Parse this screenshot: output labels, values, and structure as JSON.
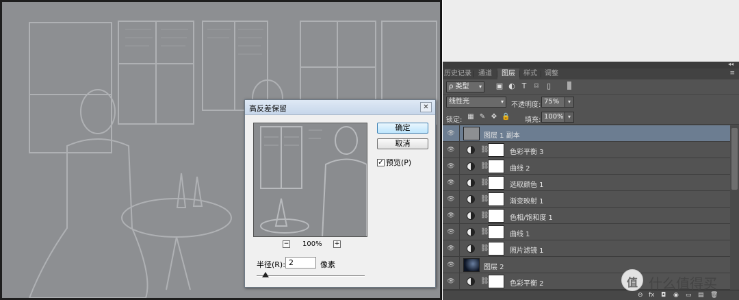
{
  "dialog": {
    "title": "高反差保留",
    "close_glyph": "✕",
    "ok": "确定",
    "cancel": "取消",
    "preview_checkbox": "预览(P)",
    "check_glyph": "✓",
    "zoom": "100%",
    "zoom_out": "−",
    "zoom_in": "+",
    "radius_label": "半径(R):",
    "radius_value": "2",
    "radius_unit": "像素",
    "radius_slider_level": 0.08
  },
  "panel": {
    "collapse_glyph": "◂◂",
    "menu_glyph": "≡",
    "tabs": [
      {
        "label": "历史记录",
        "active": false
      },
      {
        "label": "通道",
        "active": false
      },
      {
        "label": "图层",
        "active": true
      },
      {
        "label": "样式",
        "active": false
      },
      {
        "label": "调整",
        "active": false
      }
    ],
    "filter_kind": "ρ 类型",
    "filter_icons": [
      "▣",
      "◐",
      "T",
      "⌑",
      "▯"
    ],
    "blend_mode": "线性光",
    "opacity_label": "不透明度:",
    "opacity_value": "75%",
    "lock_label": "锁定:",
    "lock_icons": [
      "▦",
      "✎",
      "✥",
      "🔒"
    ],
    "fill_label": "填充:",
    "fill_value": "100%",
    "dropdown_glyph": "▾",
    "eye_glyph": "👁",
    "link_glyph": "⛓",
    "layers": [
      {
        "name": "图层 1 副本",
        "type": "pixel",
        "selected": true
      },
      {
        "name": "色彩平衡 3",
        "type": "adjustment",
        "selected": false
      },
      {
        "name": "曲线 2",
        "type": "adjustment",
        "selected": false
      },
      {
        "name": "选取颜色 1",
        "type": "adjustment",
        "selected": false
      },
      {
        "name": "渐变映射 1",
        "type": "adjustment",
        "selected": false
      },
      {
        "name": "色相/饱和度 1",
        "type": "adjustment",
        "selected": false
      },
      {
        "name": "曲线 1",
        "type": "adjustment",
        "selected": false
      },
      {
        "name": "照片滤镜 1",
        "type": "adjustment",
        "selected": false
      },
      {
        "name": "图层 2",
        "type": "photo",
        "selected": false
      },
      {
        "name": "色彩平衡 2",
        "type": "adjustment",
        "selected": false
      }
    ],
    "bottom_icons": [
      "⊖",
      "fx",
      "◘",
      "◉",
      "▭",
      "▤",
      "🗑"
    ]
  },
  "watermark": {
    "logo_glyph": "值",
    "text": "什么值得买"
  },
  "colors": {
    "photo_gray": "#8d8f92",
    "panel_bg": "#535353",
    "selected_layer": "#6c7d91"
  }
}
